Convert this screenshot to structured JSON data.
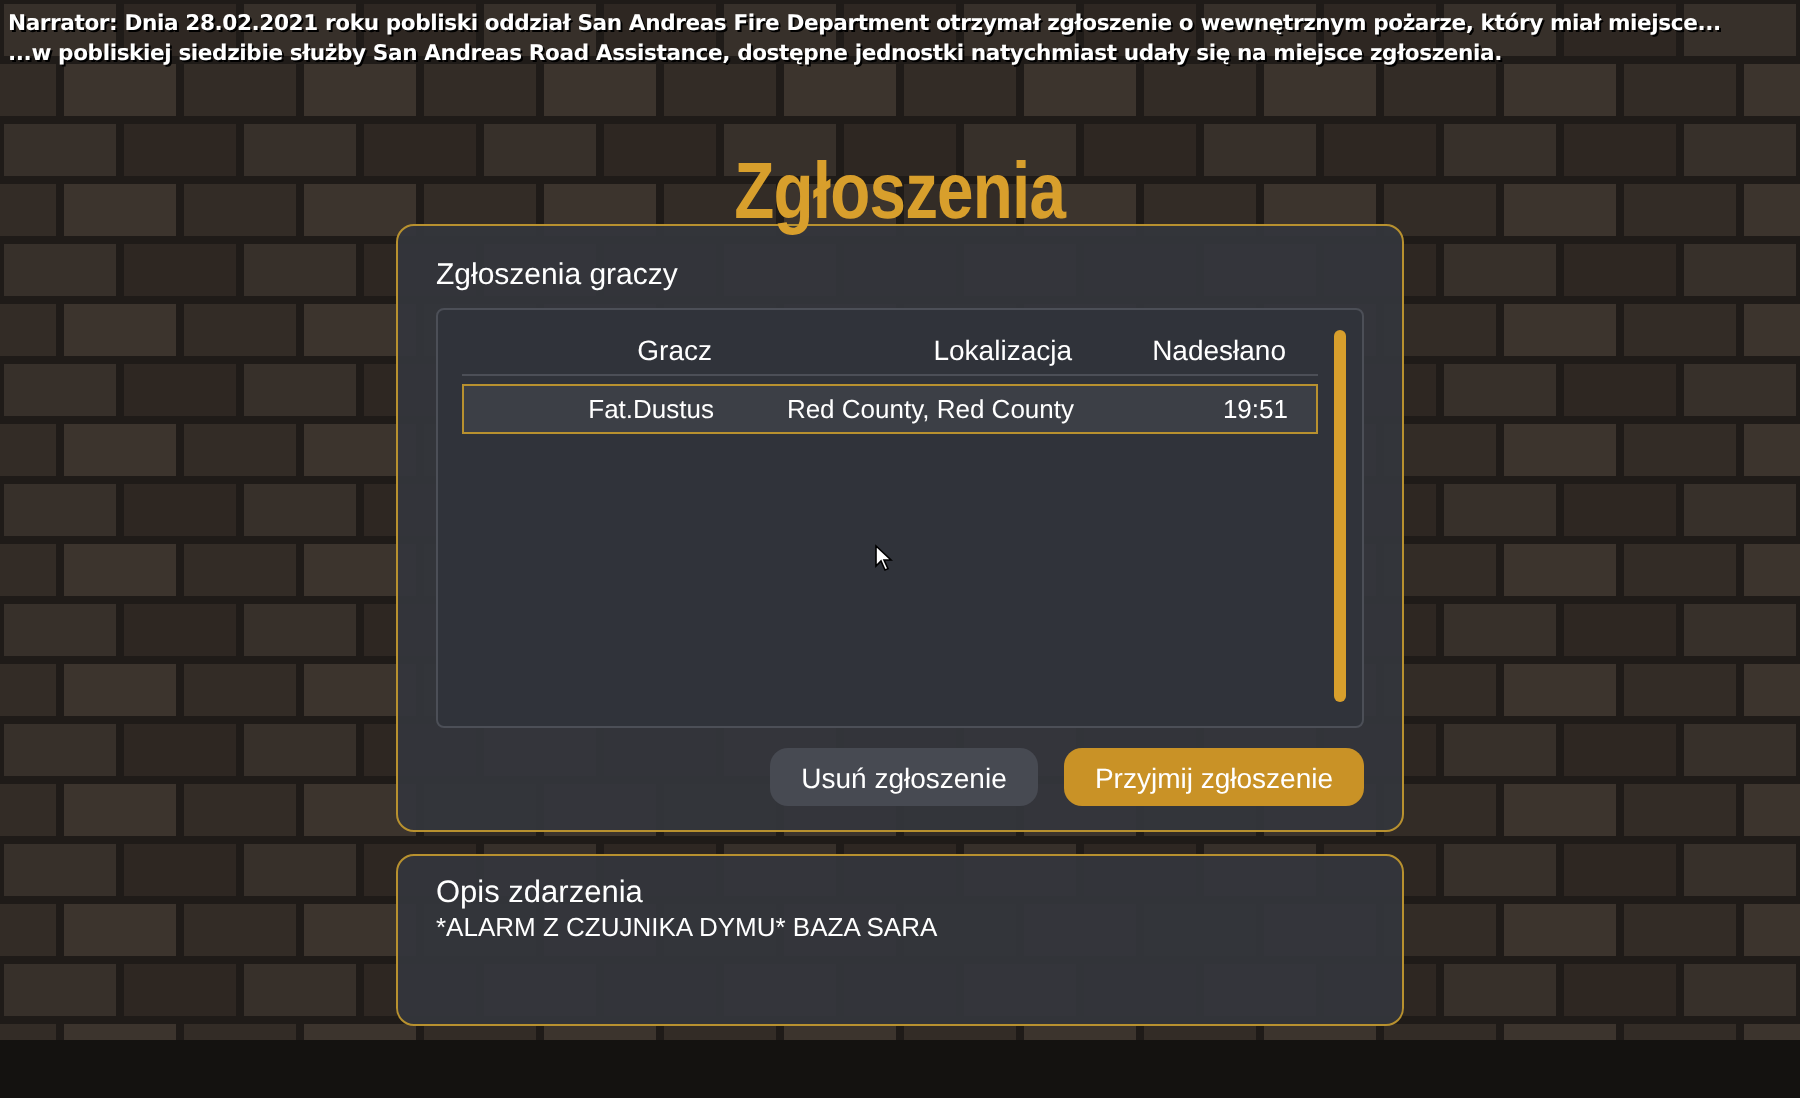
{
  "narrator": [
    "Narrator: Dnia 28.02.2021 roku pobliski oddział San Andreas Fire Department otrzymał zgłoszenie o wewnętrznym pożarze, który miał miejsce...",
    "...w pobliskiej siedzibie służby San Andreas Road Assistance, dostępne jednostki natychmiast udały się na miejsce zgłoszenia."
  ],
  "title": "Zgłoszenia",
  "reports_panel": {
    "heading": "Zgłoszenia graczy",
    "columns": [
      "Gracz",
      "Lokalizacja",
      "Nadesłano"
    ],
    "rows": [
      {
        "cells": [
          "Fat.Dustus",
          "Red County, Red County",
          "19:51"
        ],
        "selected": true
      }
    ],
    "buttons": [
      {
        "label": "Usuń zgłoszenie",
        "kind": "secondary"
      },
      {
        "label": "Przyjmij zgłoszenie",
        "kind": "primary"
      }
    ]
  },
  "description_panel": {
    "heading": "Opis zdarzenia",
    "text": "*ALARM Z CZUJNIKA DYMU* BAZA SARA"
  }
}
